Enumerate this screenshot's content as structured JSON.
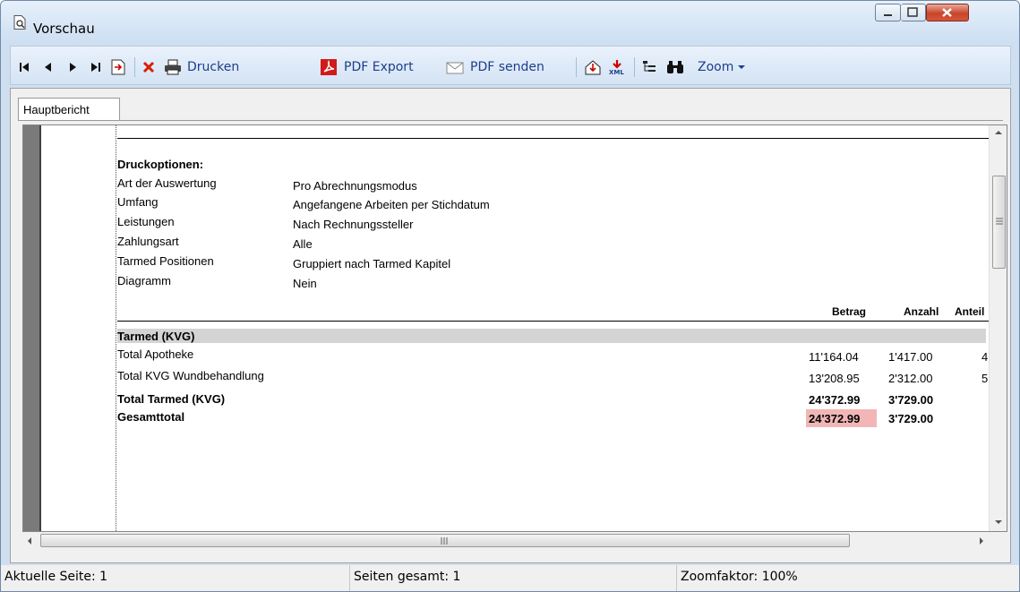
{
  "window": {
    "title": "Vorschau"
  },
  "toolbar": {
    "print_label": "Drucken",
    "pdf_export_label": "PDF Export",
    "pdf_send_label": "PDF senden",
    "zoom_label": "Zoom"
  },
  "tabs": [
    {
      "label": "Hauptbericht"
    }
  ],
  "report": {
    "options_title": "Druckoptionen:",
    "options": [
      {
        "label": "Art der Auswertung",
        "value": "Pro Abrechnungsmodus"
      },
      {
        "label": "Umfang",
        "value": "Angefangene Arbeiten per Stichdatum"
      },
      {
        "label": "Leistungen",
        "value": "Nach Rechnungssteller"
      },
      {
        "label": "Zahlungsart",
        "value": "Alle"
      },
      {
        "label": "Tarmed Positionen",
        "value": "Gruppiert nach Tarmed Kapitel"
      },
      {
        "label": "Diagramm",
        "value": "Nein"
      }
    ],
    "columns": {
      "betrag": "Betrag",
      "anzahl": "Anzahl",
      "anteil": "Anteil"
    },
    "group_title": "Tarmed (KVG)",
    "rows": [
      {
        "label": "Total Apotheke",
        "betrag": "11'164.04",
        "anzahl": "1'417.00",
        "anteil": "4"
      },
      {
        "label": "Total KVG Wundbehandlung",
        "betrag": "13'208.95",
        "anzahl": "2'312.00",
        "anteil": "5"
      }
    ],
    "subtotal": {
      "label": "Total Tarmed (KVG)",
      "betrag": "24'372.99",
      "anzahl": "3'729.00"
    },
    "grandtotal": {
      "label": "Gesamttotal",
      "betrag": "24'372.99",
      "anzahl": "3'729.00"
    }
  },
  "status": {
    "current_page": "Aktuelle Seite: 1",
    "total_pages": "Seiten gesamt: 1",
    "zoom": "Zoomfaktor: 100%"
  }
}
